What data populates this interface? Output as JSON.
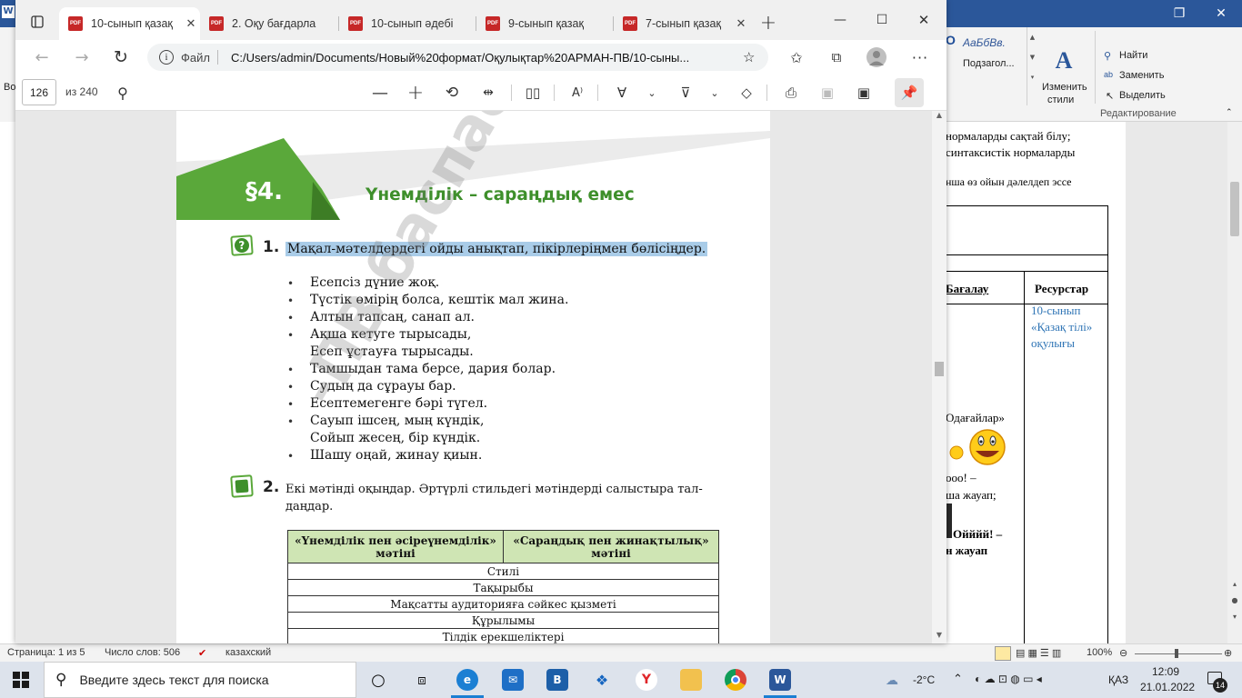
{
  "word": {
    "ribbon": {
      "style_preview": "АаБбВв.",
      "style_name": "Подзагол...",
      "change_styles_1": "Изменить",
      "change_styles_2": "стили",
      "find": "Найти",
      "replace": "Заменить",
      "select": "Выделить",
      "group_editing": "Редактирование",
      "left_fragment": "Во"
    },
    "doc": {
      "line1": "нормаларды сақтай білу;",
      "line2": "синтаксистік нормаларды",
      "line3": "нша өз ойын дәлелдеп эссе",
      "col_grading": "Бағалау",
      "col_resources": "Ресурстар",
      "resource_1": "10-сынып",
      "resource_2": "«Қазақ тілі»",
      "resource_3": "оқулығы",
      "frag_1": "Одағайлар»",
      "frag_2": "ооо! –",
      "frag_3": "ша жауап;",
      "frag_4": "Ойййй! –",
      "frag_5": "н жауап"
    },
    "status": {
      "page": "Страница: 1 из 5",
      "words": "Число слов: 506",
      "language": "казахский",
      "zoom": "100%"
    }
  },
  "edge": {
    "tabs": [
      {
        "label": "10-сынып қазақ",
        "active": true
      },
      {
        "label": "2. Оқу бағдарла",
        "active": false
      },
      {
        "label": "10-сынып әдебі",
        "active": false
      },
      {
        "label": "9-сынып қазақ",
        "active": false
      },
      {
        "label": "7-сынып қазақ",
        "active": false
      }
    ],
    "address": {
      "file_label": "Файл",
      "url": "C:/Users/admin/Documents/Новый%20формат/Оқулықтар%20АРМАН-ПВ/10-сыны..."
    },
    "pdf_toolbar": {
      "page_number": "126",
      "page_total": "из 240"
    }
  },
  "pdf_page": {
    "section_badge": "§4.",
    "title": "Үнемділік – сараңдық емес",
    "watermark": "-ПВ баспасы",
    "q1_number": "1.",
    "q1_text": "Мақал-мәтелдердегі ойды анықтап, пікірлеріңмен бөлісіңдер.",
    "proverbs": [
      "Есепсіз дүние жоқ.",
      "Түстік өмірің болса, кештік мал жина.",
      "Алтын тапсаң, санап ал.",
      "Ақша кетуге тырысады,",
      "Есеп ұстауға тырысады.",
      "Тамшыдан тама берсе, дария болар.",
      "Судың да сұрауы бар.",
      "Есептемегенге бәрі түгел.",
      "Сауып ішсең, мың күндік,",
      "Сойып жесең, бір күндік.",
      "Шашу оңай, жинау қиын."
    ],
    "q2_number": "2.",
    "q2_text_1": "Екі мәтінді оқыңдар. Әртүрлі стильдегі мәтіндерді салыстыра тал-",
    "q2_text_2": "даңдар.",
    "table": {
      "header_left_1": "«Үнемділік пен әсіреүнемділік»",
      "header_left_2": "мәтіні",
      "header_right_1": "«Сараңдық пен жинақтылық»",
      "header_right_2": "мәтіні",
      "rows": [
        "Стилі",
        "Тақырыбы",
        "Мақсатты аудиторияға сәйкес қызметі",
        "Құрылымы",
        "Тілдік ерекшеліктері"
      ]
    }
  },
  "taskbar": {
    "search_placeholder": "Введите здесь текст для поиска",
    "temperature": "-2°C",
    "language": "ҚАЗ",
    "time": "12:09",
    "date": "21.01.2022",
    "notifications": "14"
  },
  "colors": {
    "word_blue": "#2b579a",
    "section_green": "#5aa83a",
    "title_green": "#3e8f2b",
    "highlight": "#a9cce8",
    "table_header": "#cfe5b4"
  }
}
